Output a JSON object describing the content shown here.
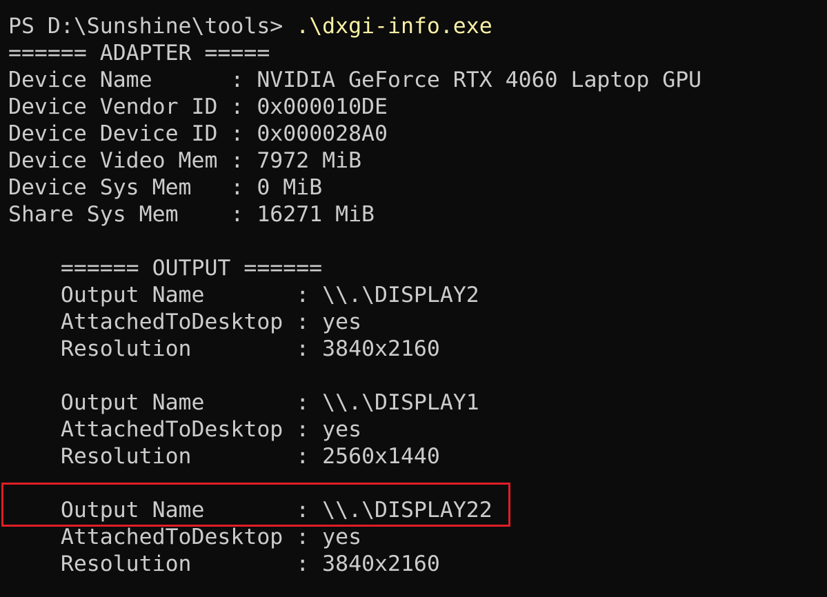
{
  "terminal": {
    "prompt": "PS D:\\Sunshine\\tools> ",
    "command": ".\\dxgi-info.exe",
    "adapter_header": "====== ADAPTER =====",
    "adapter": [
      {
        "key": "Device Name      ",
        "value": "NVIDIA GeForce RTX 4060 Laptop GPU"
      },
      {
        "key": "Device Vendor ID ",
        "value": "0x000010DE"
      },
      {
        "key": "Device Device ID ",
        "value": "0x000028A0"
      },
      {
        "key": "Device Video Mem ",
        "value": "7972 MiB"
      },
      {
        "key": "Device Sys Mem   ",
        "value": "0 MiB"
      },
      {
        "key": "Share Sys Mem    ",
        "value": "16271 MiB"
      }
    ],
    "output_header": "    ====== OUTPUT ======",
    "outputs": [
      {
        "name_key": "    Output Name       ",
        "name_value": "\\\\.\\DISPLAY2",
        "attached_key": "    AttachedToDesktop ",
        "attached_value": "yes",
        "res_key": "    Resolution        ",
        "res_value": "3840x2160"
      },
      {
        "name_key": "    Output Name       ",
        "name_value": "\\\\.\\DISPLAY1",
        "attached_key": "    AttachedToDesktop ",
        "attached_value": "yes",
        "res_key": "    Resolution        ",
        "res_value": "2560x1440"
      },
      {
        "name_key": "    Output Name       ",
        "name_value": "\\\\.\\DISPLAY22",
        "attached_key": "    AttachedToDesktop ",
        "attached_value": "yes",
        "res_key": "    Resolution        ",
        "res_value": "3840x2160"
      }
    ],
    "separator": ": ",
    "highlight_color": "#e01e25"
  }
}
